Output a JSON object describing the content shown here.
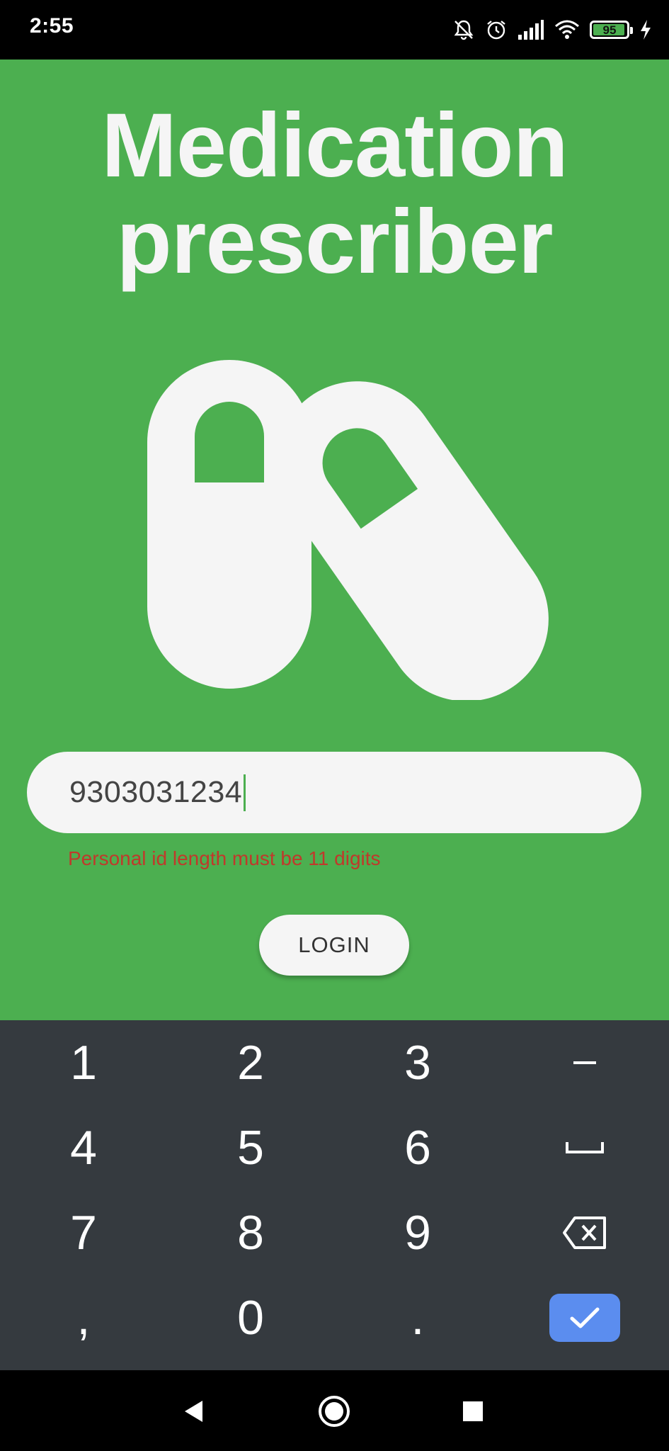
{
  "status_bar": {
    "time": "2:55",
    "battery_percent": 95,
    "battery_label": "95",
    "icons": [
      "bell-off-icon",
      "alarm-icon",
      "signal-icon",
      "wifi-icon",
      "battery-icon",
      "charging-icon"
    ]
  },
  "app": {
    "title_line1": "Medication",
    "title_line2": "prescriber",
    "logo": "pills-icon",
    "personal_id_value": "9303031234",
    "error_message": "Personal id length must be 11 digits",
    "login_label": "LOGIN",
    "colors": {
      "background": "#4caf50",
      "surface": "#f5f5f5",
      "error": "#c0392b"
    }
  },
  "keyboard": {
    "rows": [
      [
        "1",
        "2",
        "3",
        "−"
      ],
      [
        "4",
        "5",
        "6",
        "␣"
      ],
      [
        "7",
        "8",
        "9",
        "⌫"
      ],
      [
        ",",
        "0",
        ".",
        "✓"
      ]
    ],
    "accent_color": "#5b8def"
  },
  "nav_bar": {
    "icons": [
      "back-icon",
      "home-icon",
      "recents-icon"
    ]
  }
}
